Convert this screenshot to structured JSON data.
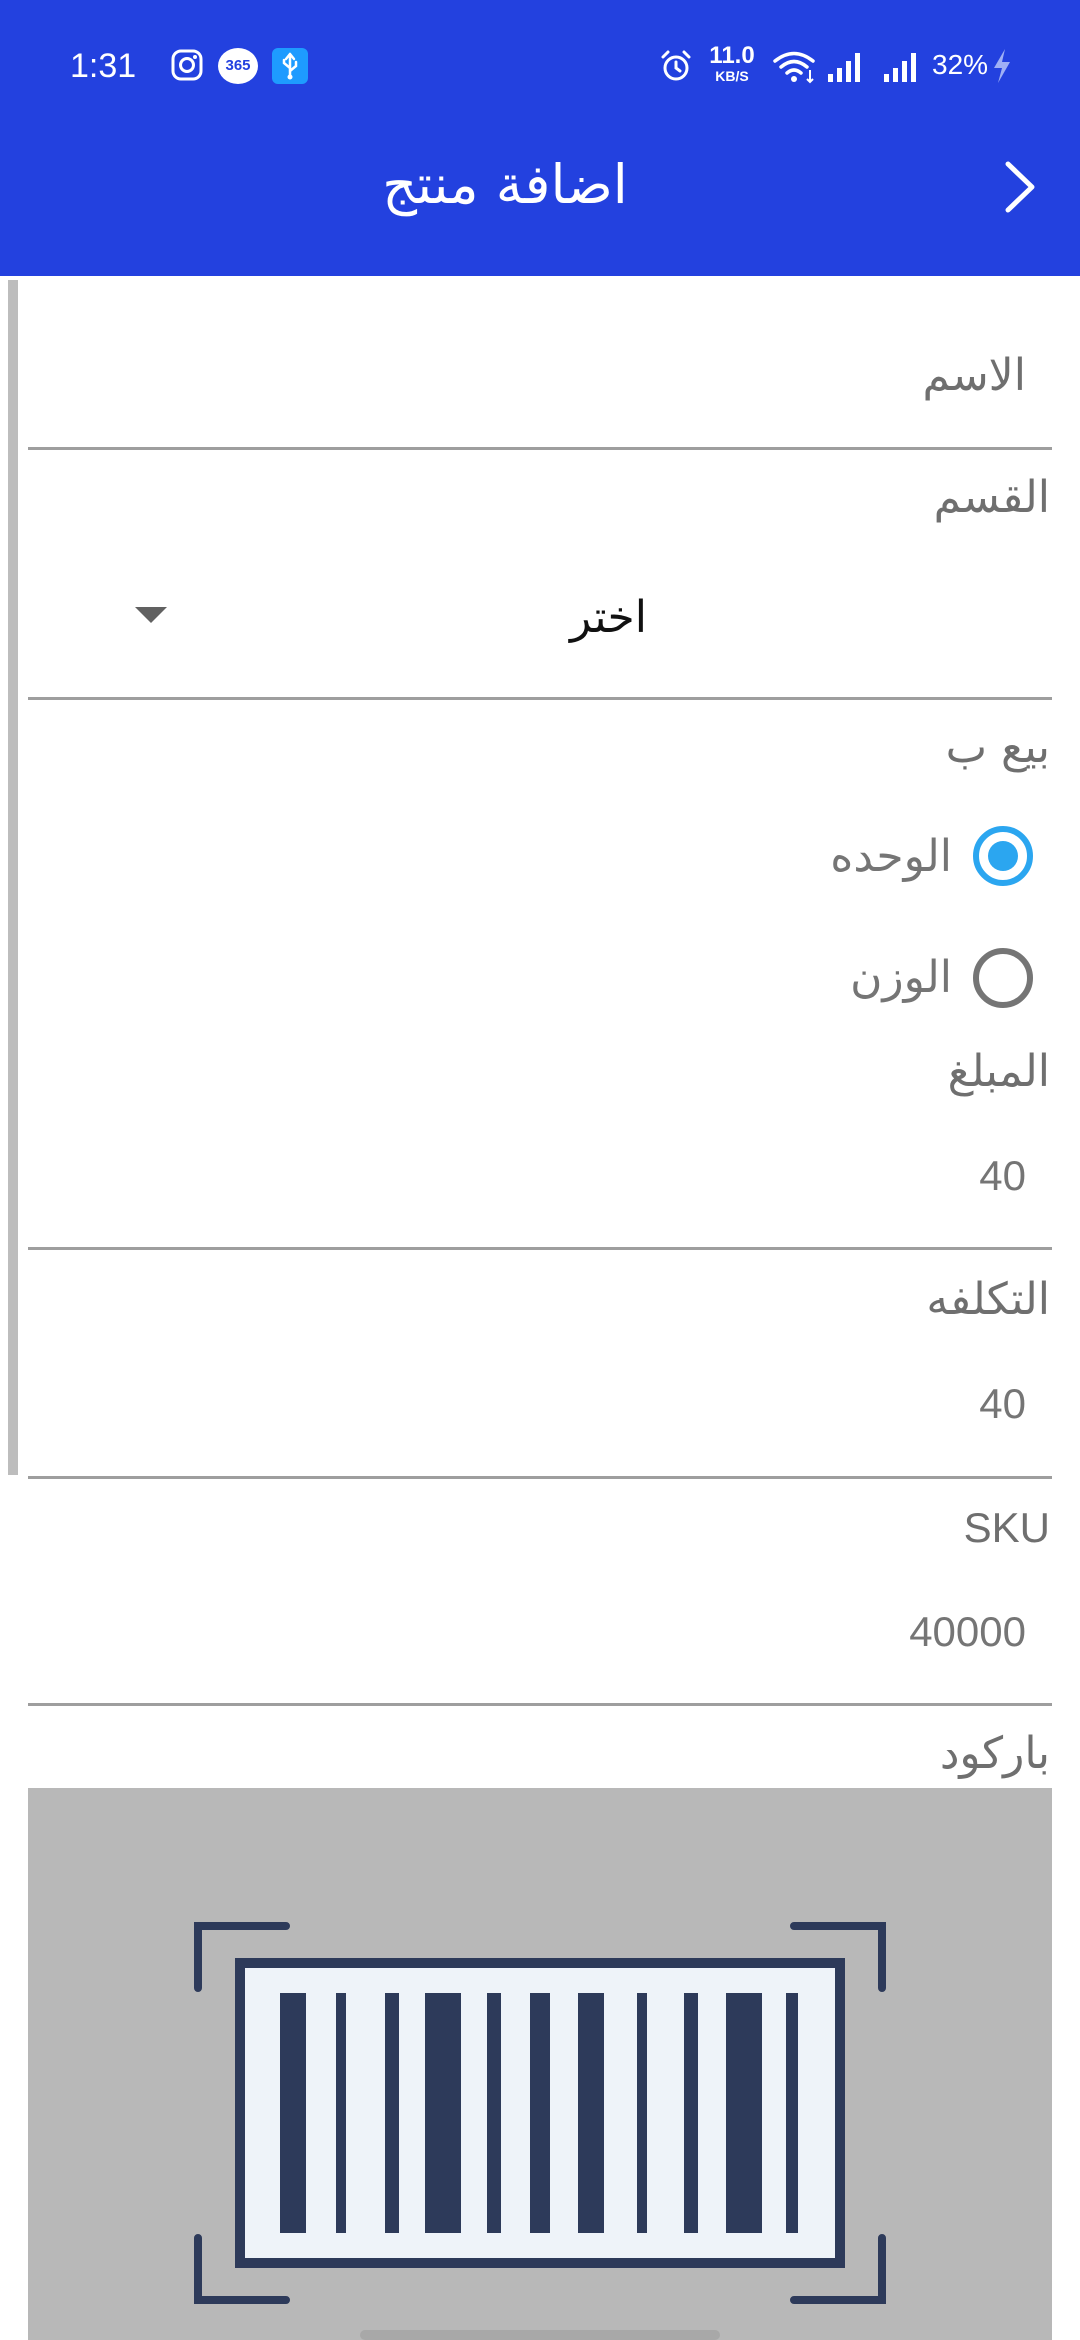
{
  "status_bar": {
    "time": "1:31",
    "speed_value": "11.0",
    "speed_unit": "KB/S",
    "battery": "32%",
    "app_badge": "365"
  },
  "header": {
    "title": "اضافة منتج"
  },
  "form": {
    "name": {
      "label": "الاسم"
    },
    "category": {
      "label": "القسم",
      "selected": "اختر"
    },
    "sell_by": {
      "label": "بيع ب",
      "options": [
        {
          "label": "الوحده",
          "selected": true
        },
        {
          "label": "الوزن",
          "selected": false
        }
      ]
    },
    "price": {
      "label": "المبلغ",
      "value": "40"
    },
    "cost": {
      "label": "التكلفه",
      "value": "40"
    },
    "sku": {
      "label": "SKU",
      "value": "40000"
    },
    "barcode": {
      "label": "باركود"
    }
  },
  "colors": {
    "primary": "#2341DF",
    "radio_active": "#2BA6F0",
    "barcode_bg": "#B8B8B8",
    "barcode_dark": "#2D3A5A"
  }
}
